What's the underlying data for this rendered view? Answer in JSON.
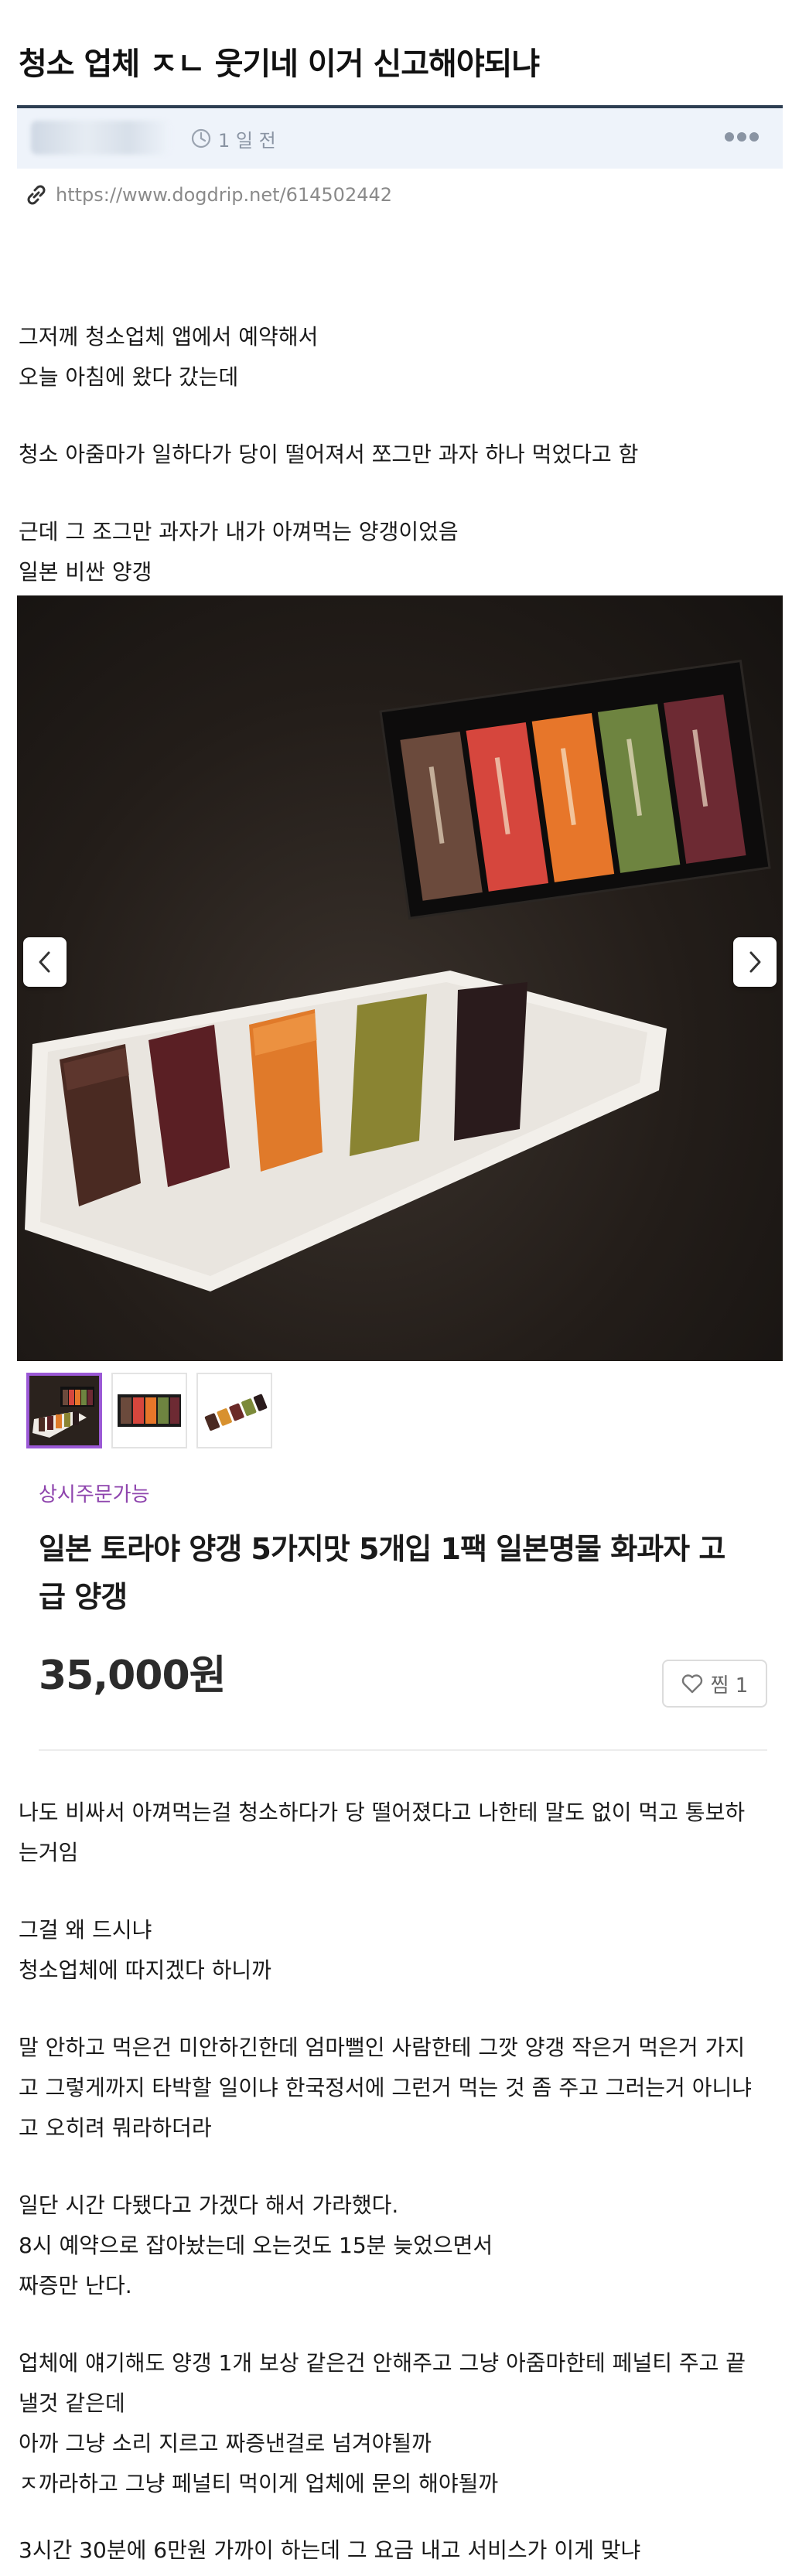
{
  "post": {
    "title": "청소 업체 ㅈㄴ 웃기네 이거 신고해야되냐",
    "time_ago": "1 일 전",
    "url": "https://www.dogdrip.net/614502442"
  },
  "body_top": [
    "그저께 청소업체 앱에서 예약해서",
    "오늘 아침에 왔다 갔는데",
    "청소 아줌마가 일하다가 당이 떨어져서 쪼그만 과자 하나 먹었다고 함",
    "근데 그 조그만 과자가 내가 아껴먹는 양갱이었음",
    "일본 비싼 양갱"
  ],
  "product": {
    "badge": "상시주문가능",
    "title_line1": "일본 토라야 양갱 5가지맛 5개입 1팩 일본명물 화과자 고",
    "title_line2": "급 양갱",
    "price": "35,000원",
    "wish_label": "찜 1"
  },
  "body_bottom": [
    "나도 비싸서 아껴먹는걸 청소하다가 당 떨어졌다고 나한테 말도 없이 먹고 통보하",
    "는거임",
    "그걸 왜 드시냐",
    "청소업체에 따지겠다 하니까",
    "말 안하고 먹은건 미안하긴한데 엄마뻘인 사람한테 그깟 양갱 작은거 먹은거 가지",
    "고 그렇게까지 타박할 일이냐 한국정서에 그런거 먹는 것 좀 주고 그러는거 아니냐",
    "고 오히려 뭐라하더라",
    "일단 시간 다됐다고 가겠다 해서 가라했다.",
    "8시 예약으로 잡아놨는데 오는것도 15분 늦었으면서",
    "짜증만 난다.",
    "업체에 얘기해도 양갱 1개 보상 같은건 안해주고 그냥 아줌마한테 페널티 주고 끝",
    "낼것 같은데",
    "아까 그냥 소리 지르고 짜증낸걸로 넘겨야될까",
    "ㅈ까라하고 그냥 페널티 먹이게 업체에 문의 해야될까",
    "3시간 30분에 6만원 가까이 하는데 그 요금 내고 서비스가 이게 맞냐"
  ],
  "icons": {
    "clock": "clock-icon",
    "more": "more-dots-icon",
    "link": "link-icon",
    "prev": "chevron-left-icon",
    "next": "chevron-right-icon",
    "heart": "heart-icon"
  },
  "colors": {
    "title_rule": "#2d3e52",
    "meta_bar": "#eef3fa",
    "badge": "#8e44ad",
    "thumb_active": "#9b59d6"
  }
}
